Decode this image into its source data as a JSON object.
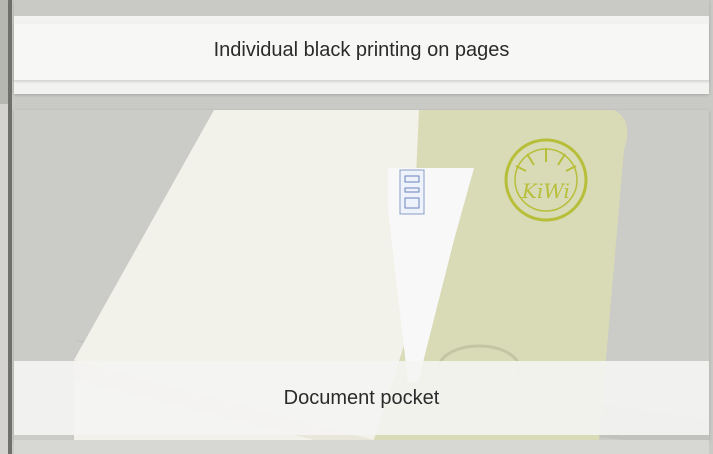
{
  "gallery": {
    "items": [
      {
        "caption": "Individual black printing on pages"
      },
      {
        "caption": "Document pocket",
        "brand_logo_text": "KiWi"
      }
    ]
  },
  "colors": {
    "card": "#f2f2f0",
    "photo_bg": "#cbcbc8",
    "notebook_cover": "#d9dbb6",
    "logo": "#b7bf3a"
  }
}
